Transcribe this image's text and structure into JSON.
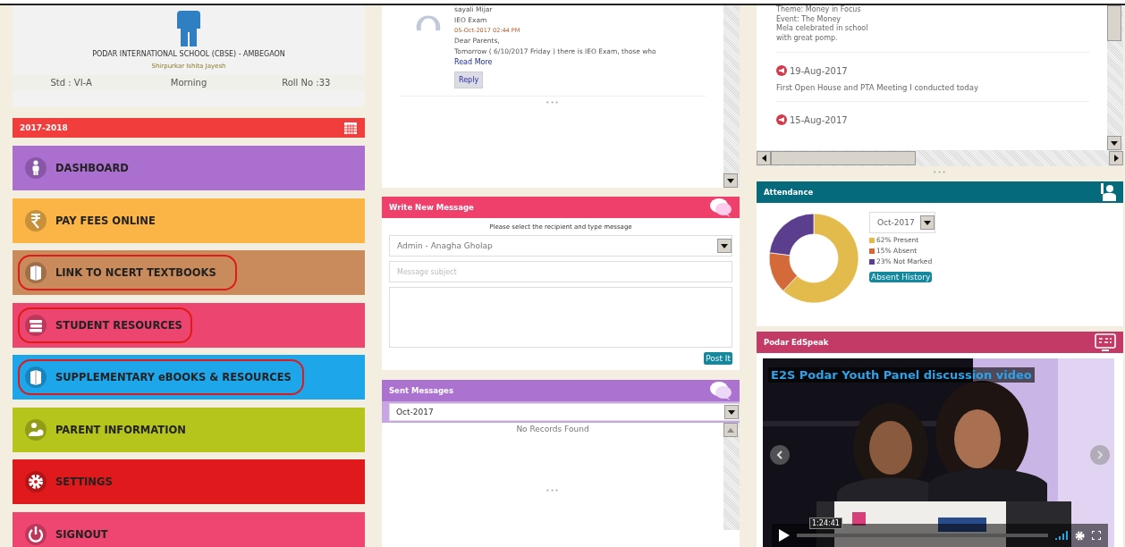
{
  "profile": {
    "school": "PODAR INTERNATIONAL SCHOOL (CBSE) - AMBEGAON",
    "student": "Shirpurkar Ishita Jayesh",
    "info": [
      "Std : VI-A",
      "Morning",
      "Roll No :33"
    ]
  },
  "year_bar": {
    "label": "2017-2018"
  },
  "menu": [
    {
      "label": "DASHBOARD",
      "color": "#ab6fd0",
      "circled": false
    },
    {
      "label": "PAY FEES ONLINE",
      "color": "#fbb446",
      "circled": false
    },
    {
      "label": "LINK TO NCERT TEXTBOOKS",
      "color": "#c98b5b",
      "circled": true
    },
    {
      "label": "STUDENT RESOURCES",
      "color": "#ec4570",
      "circled": true
    },
    {
      "label": "SUPPLEMENTARY eBOOKS & RESOURCES",
      "color": "#1ea6ea",
      "circled": true
    },
    {
      "label": "PARENT INFORMATION",
      "color": "#b6c51c",
      "circled": false
    },
    {
      "label": "SETTINGS",
      "color": "#e0191d",
      "circled": false
    },
    {
      "label": "SIGNOUT",
      "color": "#ee4571",
      "circled": false
    }
  ],
  "messages": {
    "items": [
      {
        "sender": "sayali Mijar",
        "subject": "IEO Exam",
        "date": "05-Oct-2017 02:44 PM",
        "body": [
          "Dear Parents,",
          "Tomorrow ( 6/10/2017 Friday ) there is IEO Exam, those who"
        ],
        "link": "Read More",
        "reply": "Reply"
      }
    ],
    "more": "•••"
  },
  "write_message": {
    "title": "Write New Message",
    "hint": "Please select the recipient and type message",
    "recipient": "Admin - Anagha Gholap",
    "subject_placeholder": "Message subject",
    "submit": "Post It"
  },
  "sent_messages": {
    "title": "Sent Messages",
    "month": "Oct-2017",
    "empty": "No Records Found",
    "more": "•••"
  },
  "news": {
    "intro": [
      "Theme: Money in Focus",
      "Event: The Money",
      "Mela celebrated in school",
      "with great pomp."
    ],
    "items": [
      {
        "date": "19-Aug-2017",
        "text": "First Open House and PTA Meeting I conducted today"
      },
      {
        "date": "15-Aug-2017"
      }
    ],
    "more": "•••"
  },
  "attendance": {
    "title": "Attendance",
    "month": "Oct-2017",
    "legend": [
      {
        "label": "62% Present",
        "color": "#e2bb4c"
      },
      {
        "label": "15% Absent",
        "color": "#d4693a"
      },
      {
        "label": "23% Not Marked",
        "color": "#5b3f8e"
      }
    ],
    "button": "Absent History",
    "chart_data": {
      "type": "donut",
      "values": [
        62,
        15,
        23
      ]
    }
  },
  "edspeak": {
    "title": "Podar EdSpeak",
    "video": {
      "kind": "picture",
      "title": "E2S Podar Youth Panel discussion video",
      "time": "1:24:41"
    }
  }
}
